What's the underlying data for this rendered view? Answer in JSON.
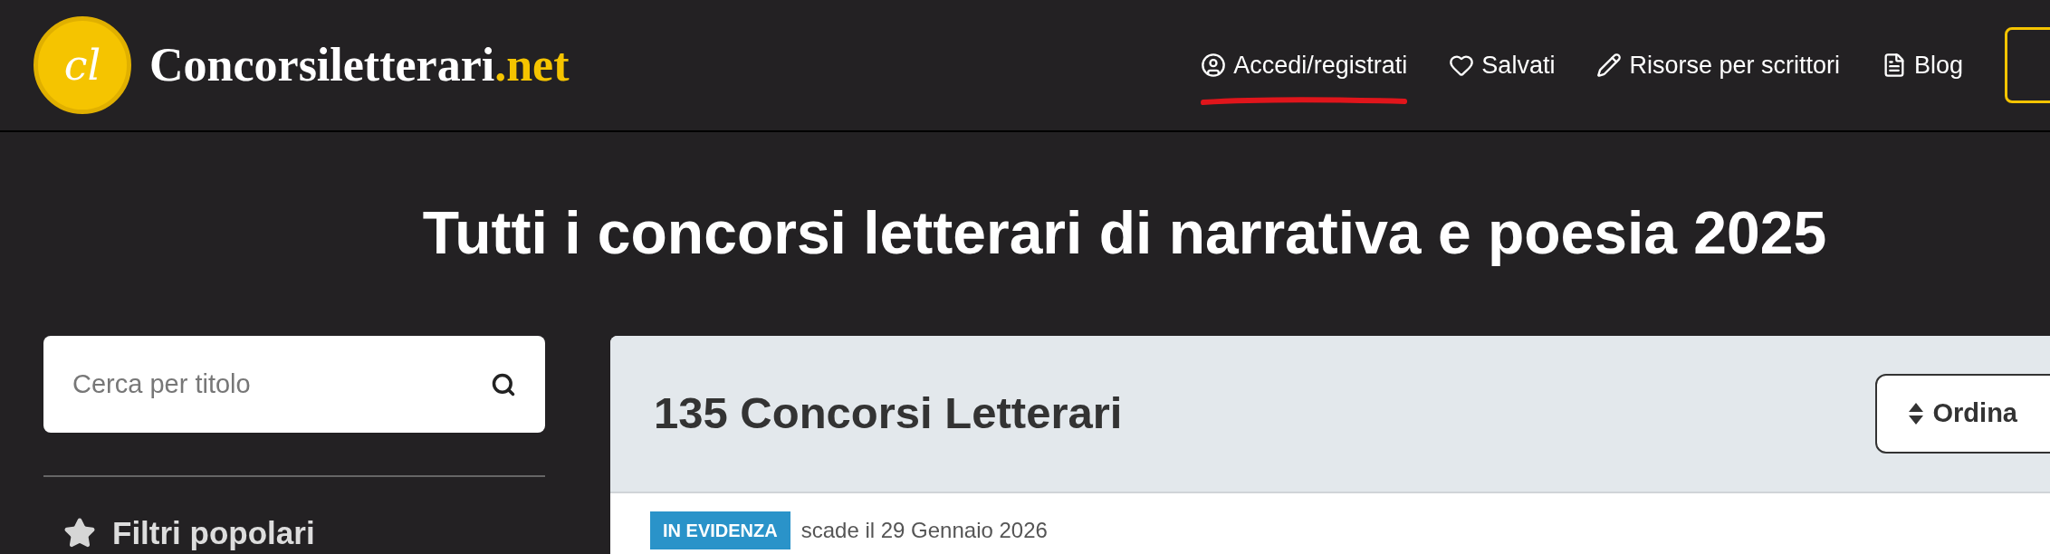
{
  "header": {
    "logo_monogram": "cl",
    "logo_name": "Concorsiletterari",
    "logo_tld": ".net",
    "nav": [
      {
        "label": "Accedi/registrati",
        "marked": true
      },
      {
        "label": "Salvati",
        "marked": false
      },
      {
        "label": "Risorse per scrittori",
        "marked": false
      },
      {
        "label": "Blog",
        "marked": false
      }
    ]
  },
  "page_title": "Tutti i concorsi letterari di narrativa e poesia 2025",
  "sidebar": {
    "search": {
      "placeholder": "Cerca per titolo"
    },
    "section_title": "Filtri popolari"
  },
  "results": {
    "count_title": "135 Concorsi Letterari",
    "sort_button": "Ordina",
    "first_item": {
      "badge": "IN EVIDENZA",
      "deadline": "scade il 29 Gennaio 2026"
    }
  }
}
